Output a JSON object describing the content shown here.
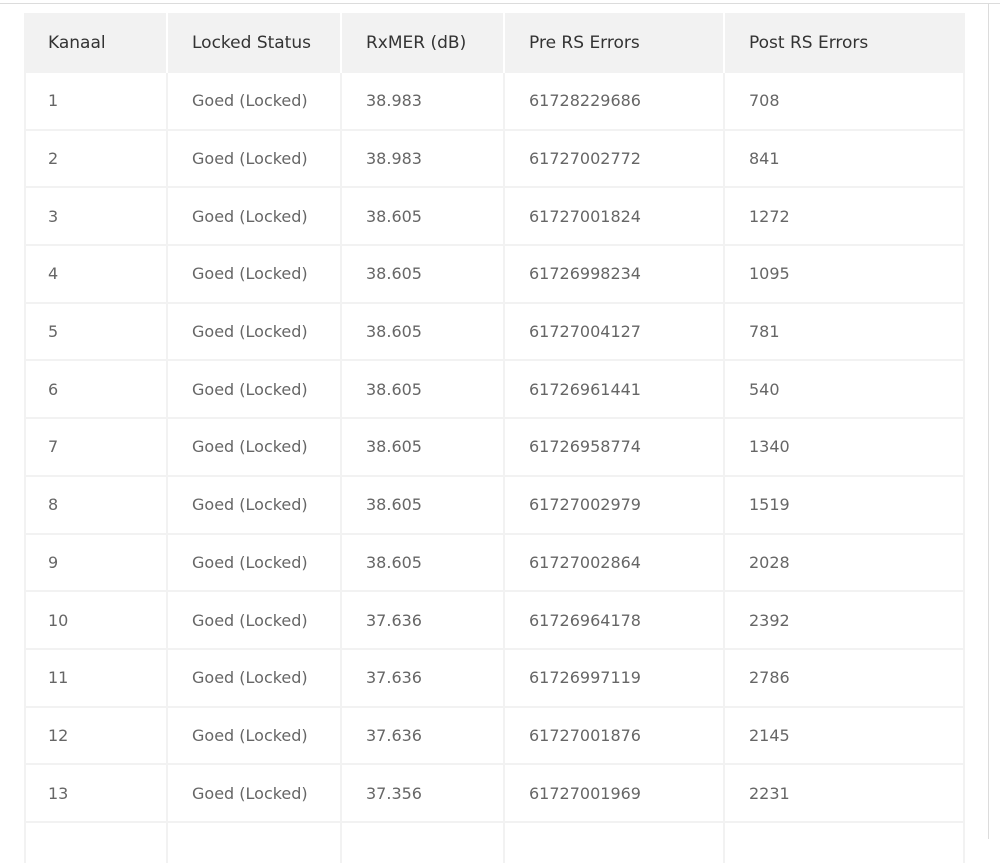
{
  "table": {
    "headers": [
      "Kanaal",
      "Locked Status",
      "RxMER (dB)",
      "Pre RS Errors",
      "Post RS Errors"
    ],
    "rows": [
      [
        "1",
        "Goed (Locked)",
        "38.983",
        "61728229686",
        "708"
      ],
      [
        "2",
        "Goed (Locked)",
        "38.983",
        "61727002772",
        "841"
      ],
      [
        "3",
        "Goed (Locked)",
        "38.605",
        "61727001824",
        "1272"
      ],
      [
        "4",
        "Goed (Locked)",
        "38.605",
        "61726998234",
        "1095"
      ],
      [
        "5",
        "Goed (Locked)",
        "38.605",
        "61727004127",
        "781"
      ],
      [
        "6",
        "Goed (Locked)",
        "38.605",
        "61726961441",
        "540"
      ],
      [
        "7",
        "Goed (Locked)",
        "38.605",
        "61726958774",
        "1340"
      ],
      [
        "8",
        "Goed (Locked)",
        "38.605",
        "61727002979",
        "1519"
      ],
      [
        "9",
        "Goed (Locked)",
        "38.605",
        "61727002864",
        "2028"
      ],
      [
        "10",
        "Goed (Locked)",
        "37.636",
        "61726964178",
        "2392"
      ],
      [
        "11",
        "Goed (Locked)",
        "37.636",
        "61726997119",
        "2786"
      ],
      [
        "12",
        "Goed (Locked)",
        "37.636",
        "61727001876",
        "2145"
      ],
      [
        "13",
        "Goed (Locked)",
        "37.356",
        "61727001969",
        "2231"
      ]
    ]
  },
  "colors": {
    "header_bg": "#f2f2f2",
    "header_text": "#333333",
    "cell_text": "#666666",
    "grid": "#f2f2f2"
  }
}
